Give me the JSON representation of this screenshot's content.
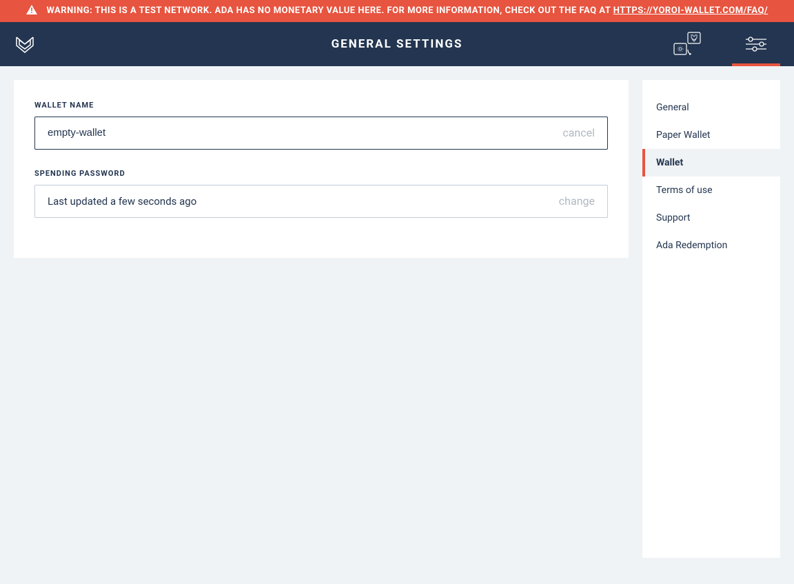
{
  "warning": {
    "prefix": "WARNING: THIS IS A TEST NETWORK. ADA HAS NO MONETARY VALUE HERE. FOR MORE INFORMATION, CHECK OUT THE FAQ AT ",
    "link_text": "HTTPS://YOROI-WALLET.COM/FAQ/"
  },
  "topbar": {
    "title": "GENERAL SETTINGS"
  },
  "fields": {
    "wallet_name": {
      "label": "WALLET NAME",
      "value": "empty-wallet",
      "action": "cancel"
    },
    "spending_password": {
      "label": "SPENDING PASSWORD",
      "status": "Last updated a few seconds ago",
      "action": "change"
    }
  },
  "sidebar": {
    "items": [
      {
        "label": "General",
        "active": false
      },
      {
        "label": "Paper Wallet",
        "active": false
      },
      {
        "label": "Wallet",
        "active": true
      },
      {
        "label": "Terms of use",
        "active": false
      },
      {
        "label": "Support",
        "active": false
      },
      {
        "label": "Ada Redemption",
        "active": false
      }
    ]
  }
}
